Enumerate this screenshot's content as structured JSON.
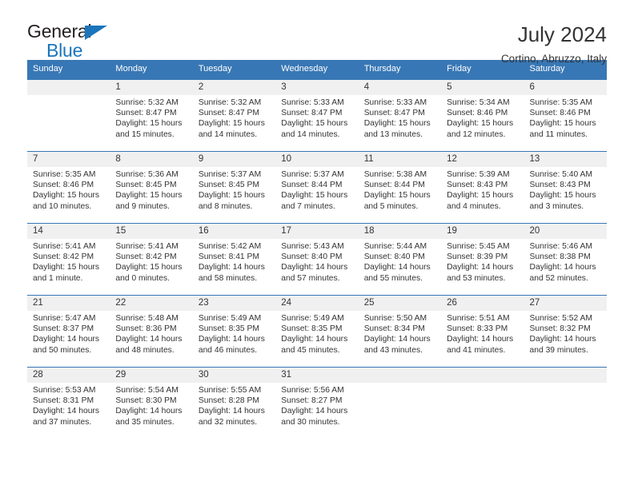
{
  "logo": {
    "word1": "General",
    "word2": "Blue",
    "triangle_color": "#1b75bb",
    "text_color": "#231f20"
  },
  "header": {
    "title": "July 2024",
    "subtitle": "Cortino, Abruzzo, Italy"
  },
  "theme": {
    "header_blue": "#3877b5",
    "daynum_band": "#f0f0f0",
    "text": "#333333"
  },
  "weekday_headers": [
    "Sunday",
    "Monday",
    "Tuesday",
    "Wednesday",
    "Thursday",
    "Friday",
    "Saturday"
  ],
  "labels": {
    "sunrise_prefix": "Sunrise:",
    "sunset_prefix": "Sunset:",
    "daylight_prefix": "Daylight:"
  },
  "weeks": [
    [
      {
        "day": "",
        "sunrise": "",
        "sunset": "",
        "daylight_line1": "",
        "daylight_line2": ""
      },
      {
        "day": "1",
        "sunrise": "Sunrise: 5:32 AM",
        "sunset": "Sunset: 8:47 PM",
        "daylight_line1": "Daylight: 15 hours",
        "daylight_line2": "and 15 minutes."
      },
      {
        "day": "2",
        "sunrise": "Sunrise: 5:32 AM",
        "sunset": "Sunset: 8:47 PM",
        "daylight_line1": "Daylight: 15 hours",
        "daylight_line2": "and 14 minutes."
      },
      {
        "day": "3",
        "sunrise": "Sunrise: 5:33 AM",
        "sunset": "Sunset: 8:47 PM",
        "daylight_line1": "Daylight: 15 hours",
        "daylight_line2": "and 14 minutes."
      },
      {
        "day": "4",
        "sunrise": "Sunrise: 5:33 AM",
        "sunset": "Sunset: 8:47 PM",
        "daylight_line1": "Daylight: 15 hours",
        "daylight_line2": "and 13 minutes."
      },
      {
        "day": "5",
        "sunrise": "Sunrise: 5:34 AM",
        "sunset": "Sunset: 8:46 PM",
        "daylight_line1": "Daylight: 15 hours",
        "daylight_line2": "and 12 minutes."
      },
      {
        "day": "6",
        "sunrise": "Sunrise: 5:35 AM",
        "sunset": "Sunset: 8:46 PM",
        "daylight_line1": "Daylight: 15 hours",
        "daylight_line2": "and 11 minutes."
      }
    ],
    [
      {
        "day": "7",
        "sunrise": "Sunrise: 5:35 AM",
        "sunset": "Sunset: 8:46 PM",
        "daylight_line1": "Daylight: 15 hours",
        "daylight_line2": "and 10 minutes."
      },
      {
        "day": "8",
        "sunrise": "Sunrise: 5:36 AM",
        "sunset": "Sunset: 8:45 PM",
        "daylight_line1": "Daylight: 15 hours",
        "daylight_line2": "and 9 minutes."
      },
      {
        "day": "9",
        "sunrise": "Sunrise: 5:37 AM",
        "sunset": "Sunset: 8:45 PM",
        "daylight_line1": "Daylight: 15 hours",
        "daylight_line2": "and 8 minutes."
      },
      {
        "day": "10",
        "sunrise": "Sunrise: 5:37 AM",
        "sunset": "Sunset: 8:44 PM",
        "daylight_line1": "Daylight: 15 hours",
        "daylight_line2": "and 7 minutes."
      },
      {
        "day": "11",
        "sunrise": "Sunrise: 5:38 AM",
        "sunset": "Sunset: 8:44 PM",
        "daylight_line1": "Daylight: 15 hours",
        "daylight_line2": "and 5 minutes."
      },
      {
        "day": "12",
        "sunrise": "Sunrise: 5:39 AM",
        "sunset": "Sunset: 8:43 PM",
        "daylight_line1": "Daylight: 15 hours",
        "daylight_line2": "and 4 minutes."
      },
      {
        "day": "13",
        "sunrise": "Sunrise: 5:40 AM",
        "sunset": "Sunset: 8:43 PM",
        "daylight_line1": "Daylight: 15 hours",
        "daylight_line2": "and 3 minutes."
      }
    ],
    [
      {
        "day": "14",
        "sunrise": "Sunrise: 5:41 AM",
        "sunset": "Sunset: 8:42 PM",
        "daylight_line1": "Daylight: 15 hours",
        "daylight_line2": "and 1 minute."
      },
      {
        "day": "15",
        "sunrise": "Sunrise: 5:41 AM",
        "sunset": "Sunset: 8:42 PM",
        "daylight_line1": "Daylight: 15 hours",
        "daylight_line2": "and 0 minutes."
      },
      {
        "day": "16",
        "sunrise": "Sunrise: 5:42 AM",
        "sunset": "Sunset: 8:41 PM",
        "daylight_line1": "Daylight: 14 hours",
        "daylight_line2": "and 58 minutes."
      },
      {
        "day": "17",
        "sunrise": "Sunrise: 5:43 AM",
        "sunset": "Sunset: 8:40 PM",
        "daylight_line1": "Daylight: 14 hours",
        "daylight_line2": "and 57 minutes."
      },
      {
        "day": "18",
        "sunrise": "Sunrise: 5:44 AM",
        "sunset": "Sunset: 8:40 PM",
        "daylight_line1": "Daylight: 14 hours",
        "daylight_line2": "and 55 minutes."
      },
      {
        "day": "19",
        "sunrise": "Sunrise: 5:45 AM",
        "sunset": "Sunset: 8:39 PM",
        "daylight_line1": "Daylight: 14 hours",
        "daylight_line2": "and 53 minutes."
      },
      {
        "day": "20",
        "sunrise": "Sunrise: 5:46 AM",
        "sunset": "Sunset: 8:38 PM",
        "daylight_line1": "Daylight: 14 hours",
        "daylight_line2": "and 52 minutes."
      }
    ],
    [
      {
        "day": "21",
        "sunrise": "Sunrise: 5:47 AM",
        "sunset": "Sunset: 8:37 PM",
        "daylight_line1": "Daylight: 14 hours",
        "daylight_line2": "and 50 minutes."
      },
      {
        "day": "22",
        "sunrise": "Sunrise: 5:48 AM",
        "sunset": "Sunset: 8:36 PM",
        "daylight_line1": "Daylight: 14 hours",
        "daylight_line2": "and 48 minutes."
      },
      {
        "day": "23",
        "sunrise": "Sunrise: 5:49 AM",
        "sunset": "Sunset: 8:35 PM",
        "daylight_line1": "Daylight: 14 hours",
        "daylight_line2": "and 46 minutes."
      },
      {
        "day": "24",
        "sunrise": "Sunrise: 5:49 AM",
        "sunset": "Sunset: 8:35 PM",
        "daylight_line1": "Daylight: 14 hours",
        "daylight_line2": "and 45 minutes."
      },
      {
        "day": "25",
        "sunrise": "Sunrise: 5:50 AM",
        "sunset": "Sunset: 8:34 PM",
        "daylight_line1": "Daylight: 14 hours",
        "daylight_line2": "and 43 minutes."
      },
      {
        "day": "26",
        "sunrise": "Sunrise: 5:51 AM",
        "sunset": "Sunset: 8:33 PM",
        "daylight_line1": "Daylight: 14 hours",
        "daylight_line2": "and 41 minutes."
      },
      {
        "day": "27",
        "sunrise": "Sunrise: 5:52 AM",
        "sunset": "Sunset: 8:32 PM",
        "daylight_line1": "Daylight: 14 hours",
        "daylight_line2": "and 39 minutes."
      }
    ],
    [
      {
        "day": "28",
        "sunrise": "Sunrise: 5:53 AM",
        "sunset": "Sunset: 8:31 PM",
        "daylight_line1": "Daylight: 14 hours",
        "daylight_line2": "and 37 minutes."
      },
      {
        "day": "29",
        "sunrise": "Sunrise: 5:54 AM",
        "sunset": "Sunset: 8:30 PM",
        "daylight_line1": "Daylight: 14 hours",
        "daylight_line2": "and 35 minutes."
      },
      {
        "day": "30",
        "sunrise": "Sunrise: 5:55 AM",
        "sunset": "Sunset: 8:28 PM",
        "daylight_line1": "Daylight: 14 hours",
        "daylight_line2": "and 32 minutes."
      },
      {
        "day": "31",
        "sunrise": "Sunrise: 5:56 AM",
        "sunset": "Sunset: 8:27 PM",
        "daylight_line1": "Daylight: 14 hours",
        "daylight_line2": "and 30 minutes."
      },
      {
        "day": "",
        "sunrise": "",
        "sunset": "",
        "daylight_line1": "",
        "daylight_line2": ""
      },
      {
        "day": "",
        "sunrise": "",
        "sunset": "",
        "daylight_line1": "",
        "daylight_line2": ""
      },
      {
        "day": "",
        "sunrise": "",
        "sunset": "",
        "daylight_line1": "",
        "daylight_line2": ""
      }
    ]
  ]
}
